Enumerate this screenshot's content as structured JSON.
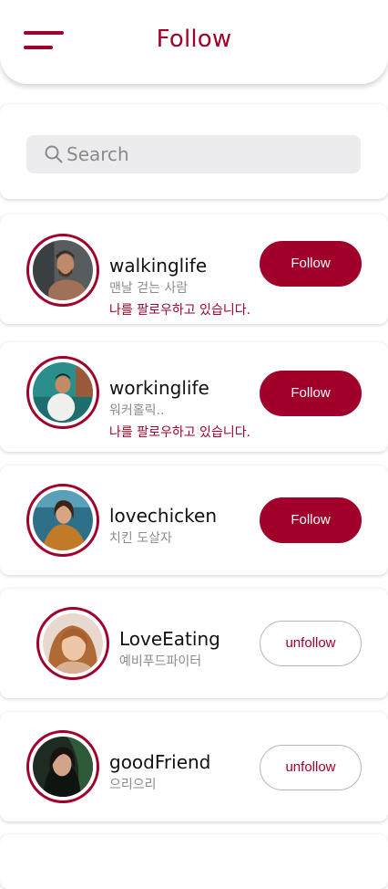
{
  "header": {
    "title": "Follow"
  },
  "search": {
    "placeholder": "Search"
  },
  "users": [
    {
      "username": "walkinglife",
      "bio": "맨날 걷는 사람",
      "follows_you": "나를 팔로우하고 있습니다.",
      "button_label": "Follow",
      "is_following": false
    },
    {
      "username": "workinglife",
      "bio": "워커홀릭..",
      "follows_you": "나를 팔로우하고 있습니다.",
      "button_label": "Follow",
      "is_following": false
    },
    {
      "username": "lovechicken",
      "bio": "치킨 도살자",
      "button_label": "Follow",
      "is_following": false
    },
    {
      "username": "LoveEating",
      "bio": "예비푸드파이터",
      "button_label": "unfollow",
      "is_following": true
    },
    {
      "username": "goodFriend",
      "bio": "으리으리",
      "button_label": "unfollow",
      "is_following": true
    }
  ],
  "colors": {
    "accent": "#a0002a",
    "search_bg": "#ececee",
    "muted_text": "#8c8c8c"
  },
  "icons": {
    "menu": "hamburger-menu-icon",
    "search": "search-icon"
  }
}
